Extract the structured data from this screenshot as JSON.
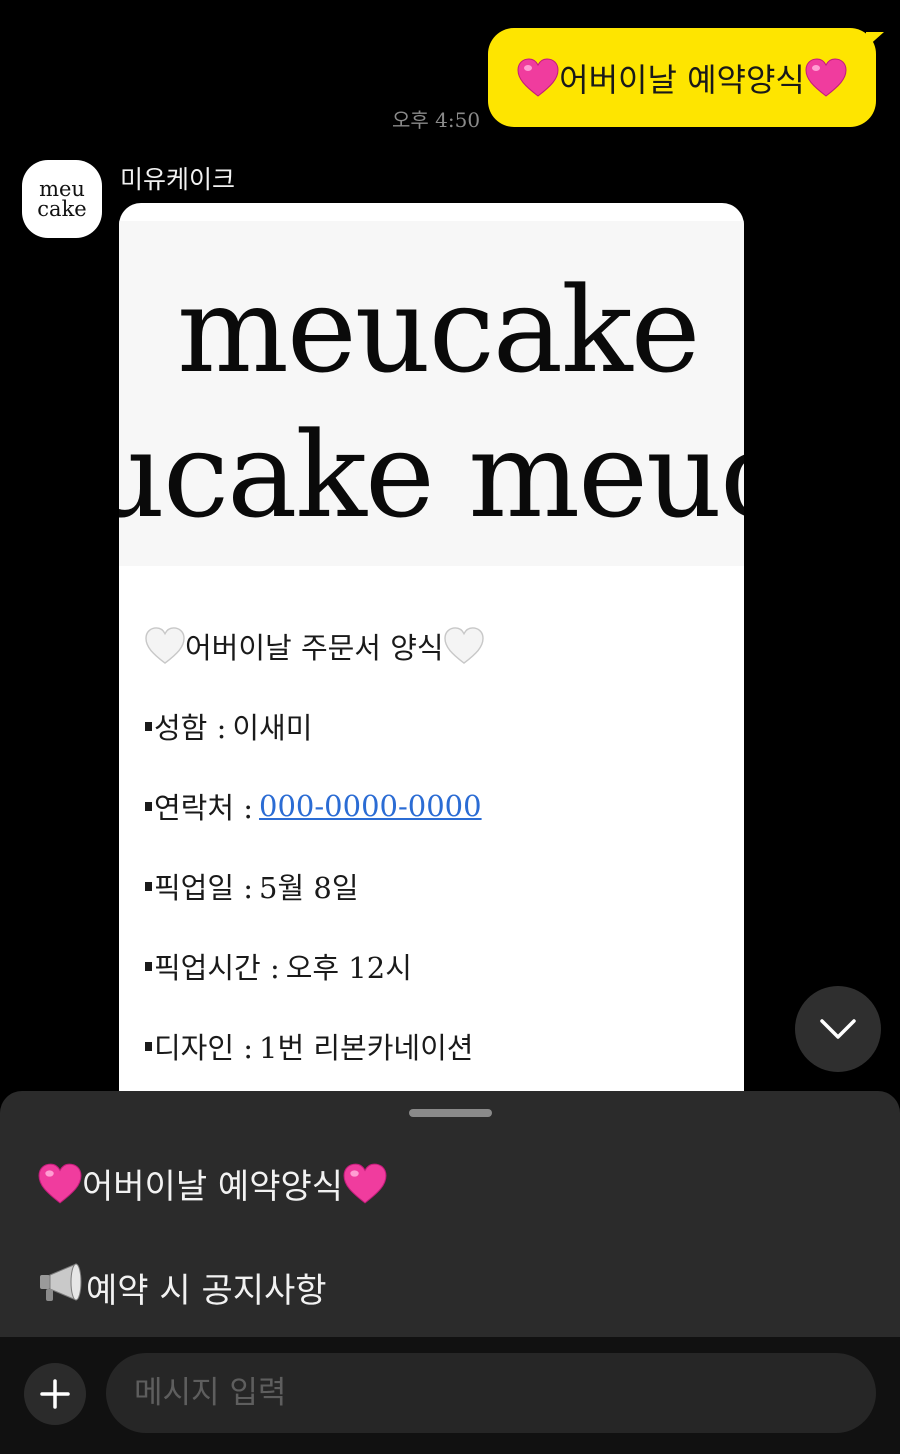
{
  "chat": {
    "outgoing": {
      "text": "어버이날 예약양식",
      "time": "오후 4:50"
    },
    "incoming": {
      "sender": "미유케이크",
      "avatar_top": "meu",
      "avatar_bottom": "cake",
      "banner_line_1": "meucake",
      "banner_line_2": "ucake  meuc",
      "form": {
        "title": "어버이날 주문서 양식",
        "rows": [
          {
            "label": "성함 :",
            "value": "이새미"
          },
          {
            "label": "연락처 :",
            "value": "000-0000-0000"
          },
          {
            "label": "픽업일 :",
            "value": "5월 8일"
          },
          {
            "label": "픽업시간 :",
            "value": "오후 12시"
          },
          {
            "label": "디자인 :",
            "value": "1번 리본카네이션"
          }
        ]
      }
    }
  },
  "quick_replies": {
    "items": [
      {
        "label": "어버이날 예약양식",
        "icon": "pink-heart-icon"
      },
      {
        "label": "예약 시 공지사항",
        "icon": "megaphone-icon"
      }
    ]
  },
  "composer": {
    "placeholder": "메시지 입력"
  },
  "colors": {
    "bubble": "#fee500",
    "link": "#2b6cd4",
    "heart": "#f03c9e"
  }
}
